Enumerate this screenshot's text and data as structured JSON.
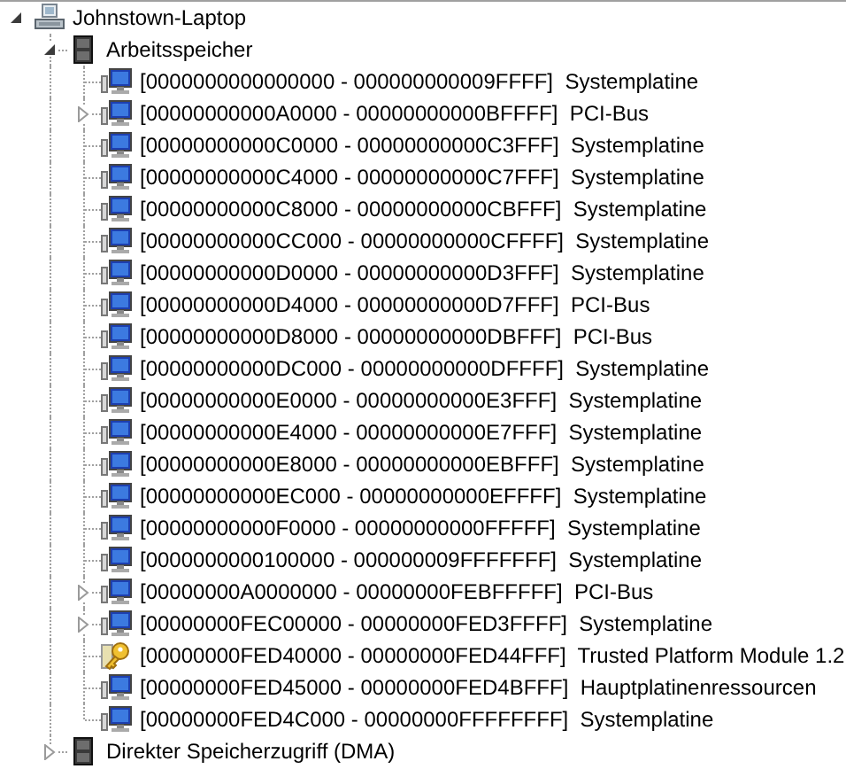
{
  "tree": [
    {
      "label": "Johnstown-Laptop",
      "kind": "computer",
      "expanded": true,
      "children": [
        {
          "label": "Arbeitsspeicher",
          "kind": "memory",
          "expanded": true,
          "children": [
            {
              "label": "[0000000000000000 - 000000000009FFFF]  Systemplatine",
              "kind": "device"
            },
            {
              "label": "[00000000000A0000 - 00000000000BFFFF]  PCI-Bus",
              "kind": "device",
              "expanded": false
            },
            {
              "label": "[00000000000C0000 - 00000000000C3FFF]  Systemplatine",
              "kind": "device"
            },
            {
              "label": "[00000000000C4000 - 00000000000C7FFF]  Systemplatine",
              "kind": "device"
            },
            {
              "label": "[00000000000C8000 - 00000000000CBFFF]  Systemplatine",
              "kind": "device"
            },
            {
              "label": "[00000000000CC000 - 00000000000CFFFF]  Systemplatine",
              "kind": "device"
            },
            {
              "label": "[00000000000D0000 - 00000000000D3FFF]  Systemplatine",
              "kind": "device"
            },
            {
              "label": "[00000000000D4000 - 00000000000D7FFF]  PCI-Bus",
              "kind": "device"
            },
            {
              "label": "[00000000000D8000 - 00000000000DBFFF]  PCI-Bus",
              "kind": "device"
            },
            {
              "label": "[00000000000DC000 - 00000000000DFFFF]  Systemplatine",
              "kind": "device"
            },
            {
              "label": "[00000000000E0000 - 00000000000E3FFF]  Systemplatine",
              "kind": "device"
            },
            {
              "label": "[00000000000E4000 - 00000000000E7FFF]  Systemplatine",
              "kind": "device"
            },
            {
              "label": "[00000000000E8000 - 00000000000EBFFF]  Systemplatine",
              "kind": "device"
            },
            {
              "label": "[00000000000EC000 - 00000000000EFFFF]  Systemplatine",
              "kind": "device"
            },
            {
              "label": "[00000000000F0000 - 00000000000FFFFF]  Systemplatine",
              "kind": "device"
            },
            {
              "label": "[0000000000100000 - 000000009FFFFFFF]  Systemplatine",
              "kind": "device"
            },
            {
              "label": "[00000000A0000000 - 00000000FEBFFFFF]  PCI-Bus",
              "kind": "device",
              "expanded": false
            },
            {
              "label": "[00000000FEC00000 - 00000000FED3FFFF]  Systemplatine",
              "kind": "device",
              "expanded": false
            },
            {
              "label": "[00000000FED40000 - 00000000FED44FFF]  Trusted Platform Module 1.2",
              "kind": "key"
            },
            {
              "label": "[00000000FED45000 - 00000000FED4BFFF]  Hauptplatinenressourcen",
              "kind": "device"
            },
            {
              "label": "[00000000FED4C000 - 00000000FFFFFFFF]  Systemplatine",
              "kind": "device"
            }
          ]
        },
        {
          "label": "Direkter Speicherzugriff (DMA)",
          "kind": "memory",
          "expanded": false
        }
      ]
    }
  ]
}
